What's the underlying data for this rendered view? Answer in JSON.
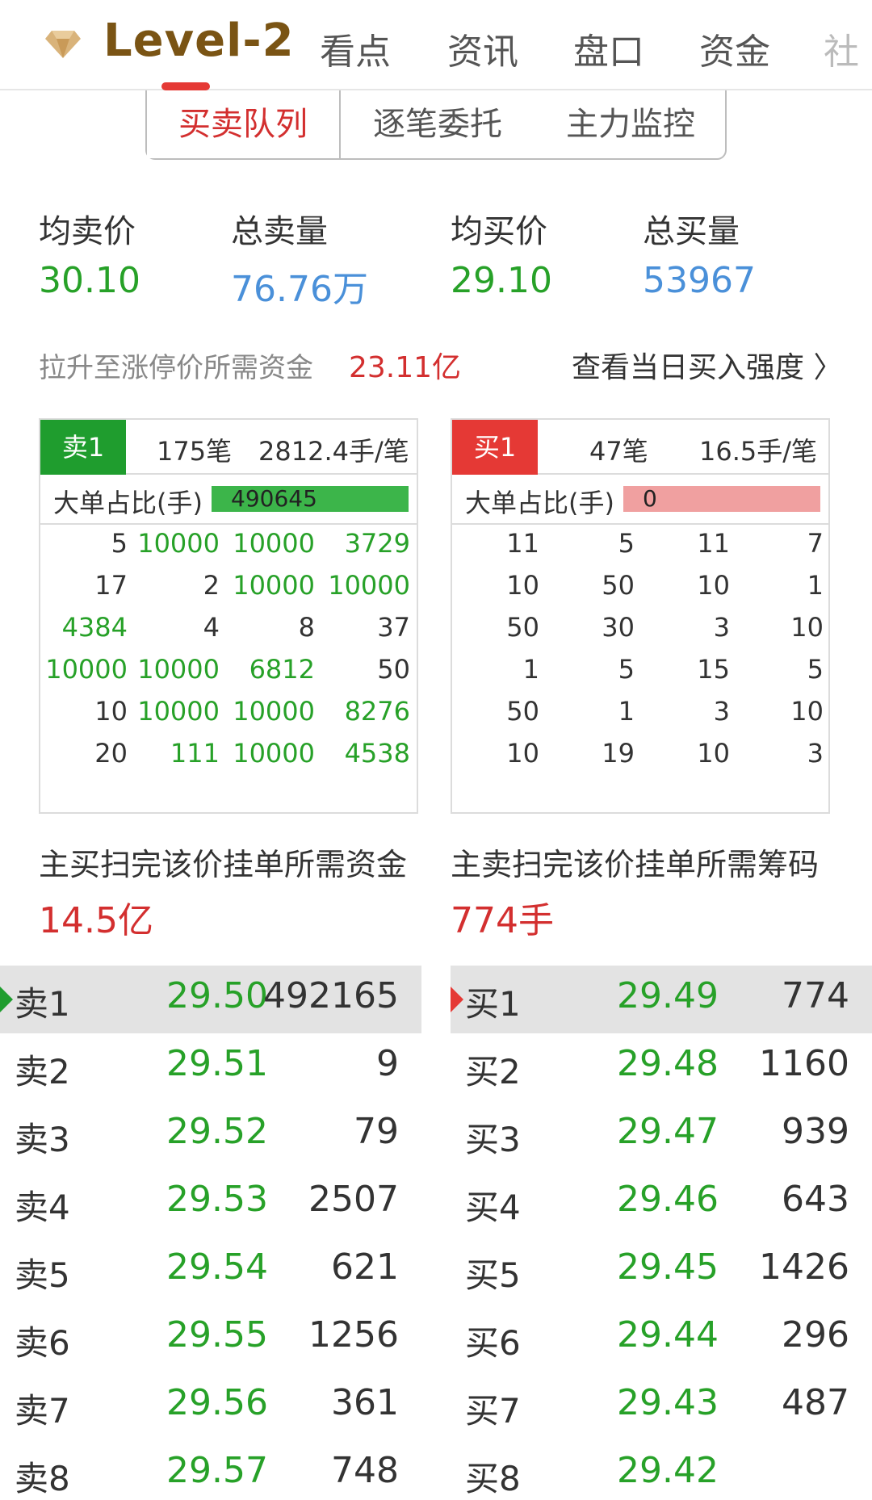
{
  "nav": {
    "brand": "Level-2",
    "tabs": [
      "看点",
      "资讯",
      "盘口",
      "资金",
      "社"
    ]
  },
  "subtabs": [
    "买卖队列",
    "逐笔委托",
    "主力监控"
  ],
  "stats": [
    {
      "label": "均卖价",
      "value": "30.10"
    },
    {
      "label": "总卖量",
      "value": "76.76万"
    },
    {
      "label": "均买价",
      "value": "29.10"
    },
    {
      "label": "总买量",
      "value": "53967"
    }
  ],
  "lift": {
    "label": "拉升至涨停价所需资金",
    "value": "23.11亿",
    "link": "查看当日买入强度 〉"
  },
  "sell_panel": {
    "badge": "卖1",
    "count": "175笔",
    "avg": "2812.4手/笔",
    "bigorder_label": "大单占比(手)",
    "bigorder_value": "490645",
    "rows": [
      [
        "5",
        "10000",
        "10000",
        "3729"
      ],
      [
        "17",
        "2",
        "10000",
        "10000"
      ],
      [
        "4384",
        "4",
        "8",
        "37"
      ],
      [
        "10000",
        "10000",
        "6812",
        "50"
      ],
      [
        "10",
        "10000",
        "10000",
        "8276"
      ],
      [
        "20",
        "111",
        "10000",
        "4538"
      ]
    ]
  },
  "buy_panel": {
    "badge": "买1",
    "count": "47笔",
    "avg": "16.5手/笔",
    "bigorder_label": "大单占比(手)",
    "bigorder_value": "0",
    "rows": [
      [
        "11",
        "5",
        "11",
        "7"
      ],
      [
        "10",
        "50",
        "10",
        "1"
      ],
      [
        "50",
        "30",
        "3",
        "10"
      ],
      [
        "1",
        "5",
        "15",
        "5"
      ],
      [
        "50",
        "1",
        "3",
        "10"
      ],
      [
        "10",
        "19",
        "10",
        "3"
      ]
    ]
  },
  "sweep": {
    "buy_label": "主买扫完该价挂单所需资金",
    "buy_value": "14.5亿",
    "sell_label": "主卖扫完该价挂单所需筹码",
    "sell_value": "774手"
  },
  "asks": [
    {
      "label": "卖1",
      "price": "29.50",
      "vol": "492165"
    },
    {
      "label": "卖2",
      "price": "29.51",
      "vol": "9"
    },
    {
      "label": "卖3",
      "price": "29.52",
      "vol": "79"
    },
    {
      "label": "卖4",
      "price": "29.53",
      "vol": "2507"
    },
    {
      "label": "卖5",
      "price": "29.54",
      "vol": "621"
    },
    {
      "label": "卖6",
      "price": "29.55",
      "vol": "1256"
    },
    {
      "label": "卖7",
      "price": "29.56",
      "vol": "361"
    },
    {
      "label": "卖8",
      "price": "29.57",
      "vol": "748"
    }
  ],
  "bids": [
    {
      "label": "买1",
      "price": "29.49",
      "vol": "774"
    },
    {
      "label": "买2",
      "price": "29.48",
      "vol": "1160"
    },
    {
      "label": "买3",
      "price": "29.47",
      "vol": "939"
    },
    {
      "label": "买4",
      "price": "29.46",
      "vol": "643"
    },
    {
      "label": "买5",
      "price": "29.45",
      "vol": "1426"
    },
    {
      "label": "买6",
      "price": "29.44",
      "vol": "296"
    },
    {
      "label": "买7",
      "price": "29.43",
      "vol": "487"
    },
    {
      "label": "买8",
      "price": "29.42",
      "vol": ""
    }
  ]
}
